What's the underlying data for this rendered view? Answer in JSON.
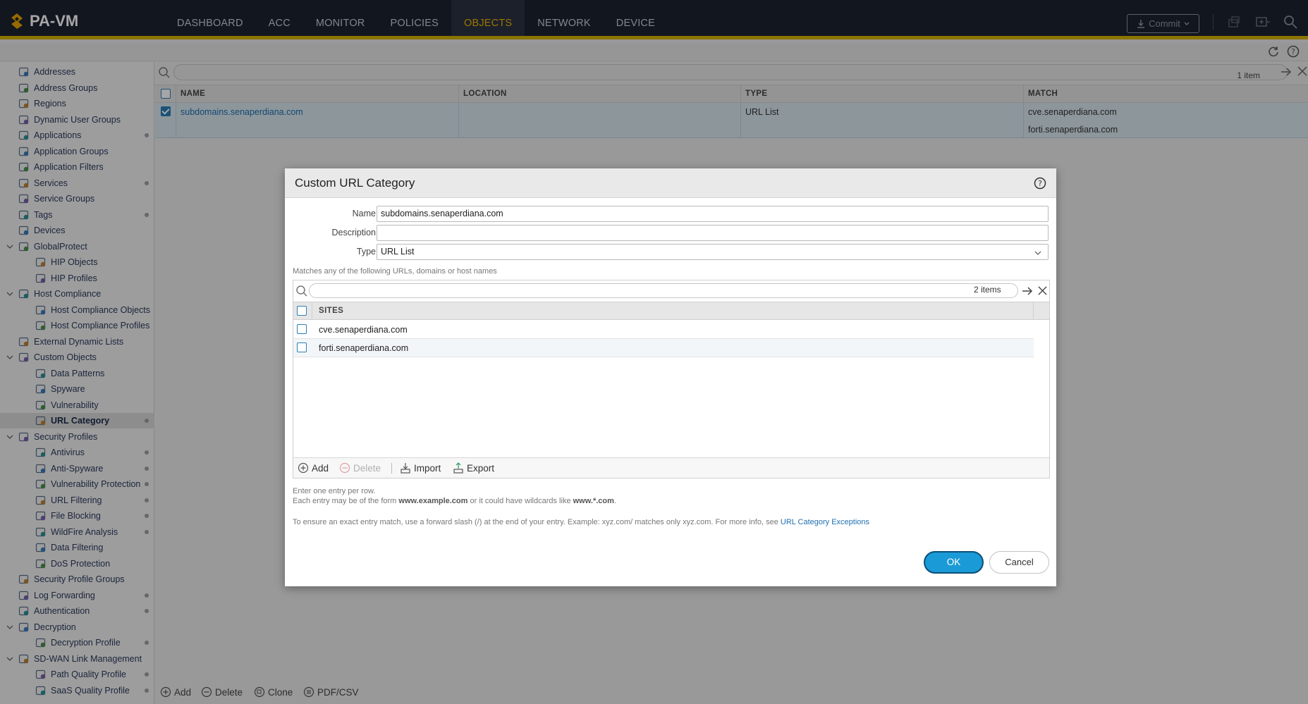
{
  "app": {
    "brand": "PA-VM"
  },
  "nav": {
    "items": [
      "DASHBOARD",
      "ACC",
      "MONITOR",
      "POLICIES",
      "OBJECTS",
      "NETWORK",
      "DEVICE"
    ],
    "active": "OBJECTS",
    "commit_label": "Commit"
  },
  "sidebar": {
    "items": [
      {
        "label": "Addresses",
        "level": 0,
        "dot": false
      },
      {
        "label": "Address Groups",
        "level": 0,
        "dot": false
      },
      {
        "label": "Regions",
        "level": 0,
        "dot": false
      },
      {
        "label": "Dynamic User Groups",
        "level": 0,
        "dot": false
      },
      {
        "label": "Applications",
        "level": 0,
        "dot": true
      },
      {
        "label": "Application Groups",
        "level": 0,
        "dot": false
      },
      {
        "label": "Application Filters",
        "level": 0,
        "dot": false
      },
      {
        "label": "Services",
        "level": 0,
        "dot": true
      },
      {
        "label": "Service Groups",
        "level": 0,
        "dot": false
      },
      {
        "label": "Tags",
        "level": 0,
        "dot": true
      },
      {
        "label": "Devices",
        "level": 0,
        "dot": false
      },
      {
        "label": "GlobalProtect",
        "level": 0,
        "dot": false,
        "expand": true
      },
      {
        "label": "HIP Objects",
        "level": 1,
        "dot": false
      },
      {
        "label": "HIP Profiles",
        "level": 1,
        "dot": false
      },
      {
        "label": "Host Compliance",
        "level": 0,
        "dot": false,
        "expand": true
      },
      {
        "label": "Host Compliance Objects",
        "level": 1,
        "dot": false
      },
      {
        "label": "Host Compliance Profiles",
        "level": 1,
        "dot": false
      },
      {
        "label": "External Dynamic Lists",
        "level": 0,
        "dot": false
      },
      {
        "label": "Custom Objects",
        "level": 0,
        "dot": false,
        "expand": true
      },
      {
        "label": "Data Patterns",
        "level": 1,
        "dot": false
      },
      {
        "label": "Spyware",
        "level": 1,
        "dot": false
      },
      {
        "label": "Vulnerability",
        "level": 1,
        "dot": false
      },
      {
        "label": "URL Category",
        "level": 1,
        "dot": true,
        "selected": true
      },
      {
        "label": "Security Profiles",
        "level": 0,
        "dot": false,
        "expand": true
      },
      {
        "label": "Antivirus",
        "level": 1,
        "dot": true
      },
      {
        "label": "Anti-Spyware",
        "level": 1,
        "dot": true
      },
      {
        "label": "Vulnerability Protection",
        "level": 1,
        "dot": true
      },
      {
        "label": "URL Filtering",
        "level": 1,
        "dot": true
      },
      {
        "label": "File Blocking",
        "level": 1,
        "dot": true
      },
      {
        "label": "WildFire Analysis",
        "level": 1,
        "dot": true
      },
      {
        "label": "Data Filtering",
        "level": 1,
        "dot": false
      },
      {
        "label": "DoS Protection",
        "level": 1,
        "dot": false
      },
      {
        "label": "Security Profile Groups",
        "level": 0,
        "dot": false
      },
      {
        "label": "Log Forwarding",
        "level": 0,
        "dot": true
      },
      {
        "label": "Authentication",
        "level": 0,
        "dot": true
      },
      {
        "label": "Decryption",
        "level": 0,
        "dot": false,
        "expand": true
      },
      {
        "label": "Decryption Profile",
        "level": 1,
        "dot": true
      },
      {
        "label": "SD-WAN Link Management",
        "level": 0,
        "dot": false,
        "expand": true
      },
      {
        "label": "Path Quality Profile",
        "level": 1,
        "dot": true
      },
      {
        "label": "SaaS Quality Profile",
        "level": 1,
        "dot": true
      }
    ]
  },
  "main": {
    "count": "1 item",
    "columns": [
      "NAME",
      "LOCATION",
      "TYPE",
      "MATCH"
    ],
    "rows": [
      {
        "name": "subdomains.senaperdiana.com",
        "location": "",
        "type": "URL List",
        "match": [
          "cve.senaperdiana.com",
          "forti.senaperdiana.com"
        ]
      }
    ]
  },
  "bottom_toolbar": {
    "add": "Add",
    "delete": "Delete",
    "clone": "Clone",
    "pdf": "PDF/CSV"
  },
  "dialog": {
    "title": "Custom URL Category",
    "name_label": "Name",
    "name_value": "subdomains.senaperdiana.com",
    "description_label": "Description",
    "description_value": "",
    "type_label": "Type",
    "type_value": "URL List",
    "match_hint": "Matches any of the following URLs, domains or host names",
    "sites_count": "2 items",
    "sites_header": "SITES",
    "sites": [
      "cve.senaperdiana.com",
      "forti.senaperdiana.com"
    ],
    "footer": {
      "add": "Add",
      "delete": "Delete",
      "import": "Import",
      "export": "Export"
    },
    "help1": "Enter one entry per row.",
    "help2_prefix": "Each entry may be of the form ",
    "help2_example1": "www.example.com",
    "help2_mid": " or it could have wildcards like ",
    "help2_example2": "www.*.com",
    "help2_suffix": ".",
    "help3": "To ensure an exact entry match, use a forward slash (/) at the end of your entry. Example: xyz.com/ matches only xyz.com. For more info, see ",
    "help3_link": "URL Category Exceptions",
    "ok": "OK",
    "cancel": "Cancel"
  },
  "colors": {
    "accent": "#d8b200",
    "primary": "#1a9ad6",
    "link": "#1f6fb0",
    "nav_bg": "#1b2230"
  }
}
